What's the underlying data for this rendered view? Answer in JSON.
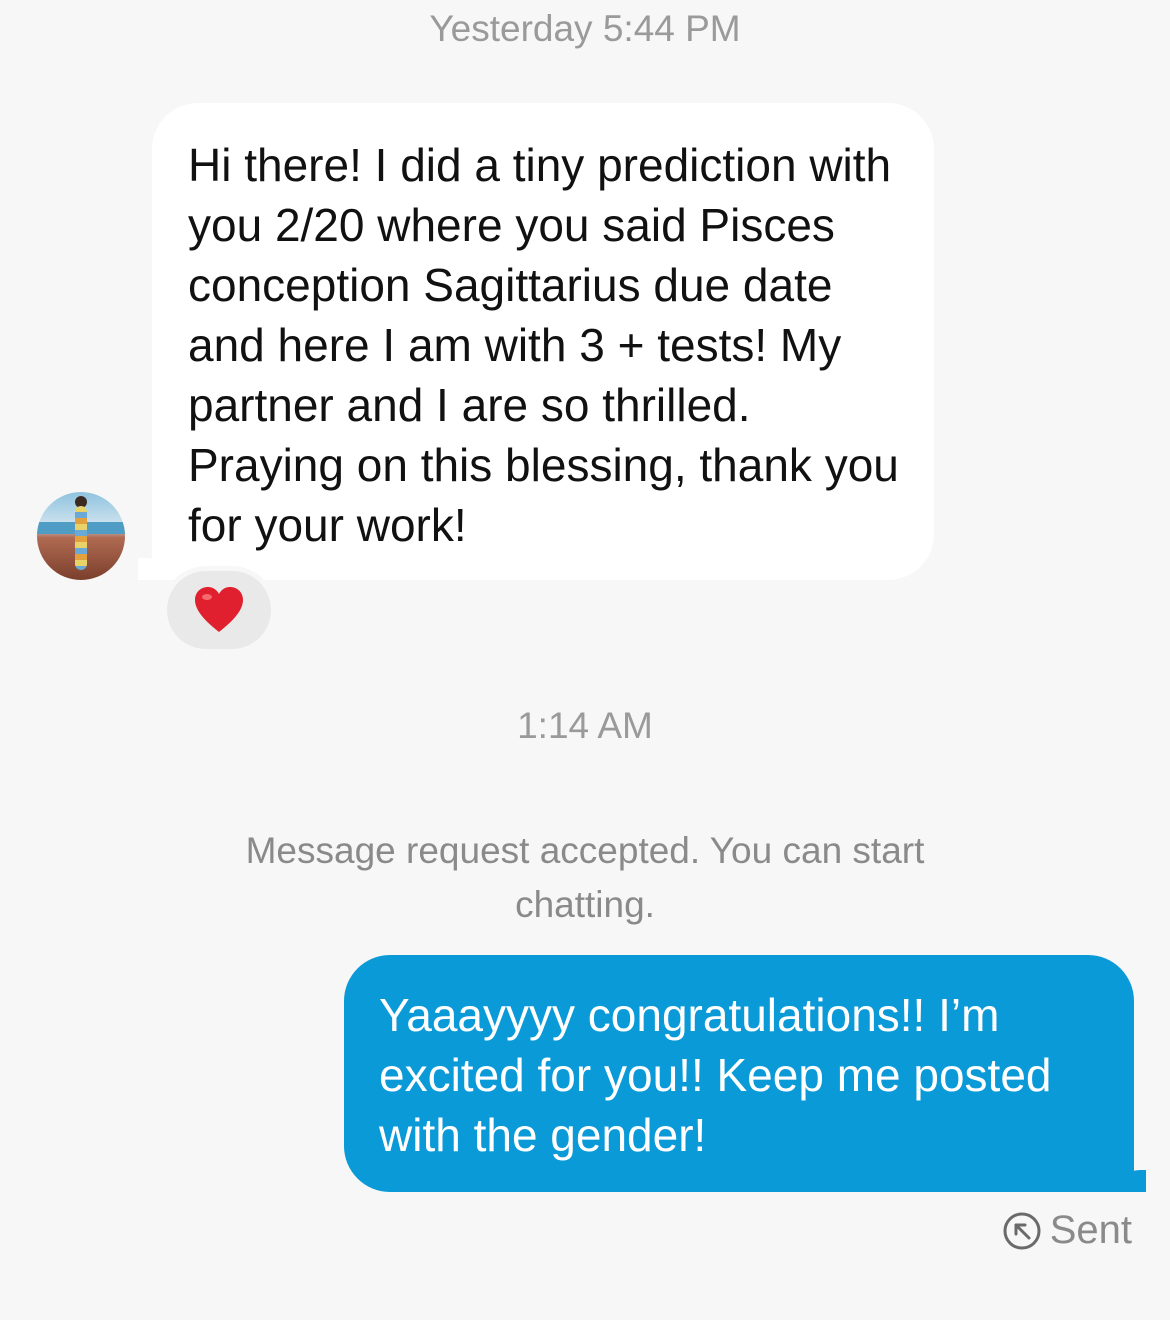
{
  "thread": {
    "timestamp_1": "Yesterday 5:44 PM",
    "incoming_message": "Hi there! I did a tiny prediction with you 2/20 where you said Pisces conception Sagittarius due date and here I am with 3 + tests! My partner and I are so thrilled. Praying on this blessing, thank you for your work!",
    "incoming_reaction": "heart-emoji",
    "timestamp_2": "1:14 AM",
    "system_note": "Message request accepted. You can start chatting.",
    "outgoing_message": "Yaaayyyy congratulations!! I’m excited for you!! Keep me posted with the gender!",
    "status": "Sent"
  },
  "colors": {
    "background": "#f7f7f7",
    "incoming_bubble": "#ffffff",
    "outgoing_bubble": "#0b9ad8",
    "reaction_pill": "#e9e9e9",
    "heart": "#e0202e",
    "meta_text": "#9a9a9a"
  },
  "icons": {
    "status_icon": "sent-arrow-circle-icon"
  }
}
